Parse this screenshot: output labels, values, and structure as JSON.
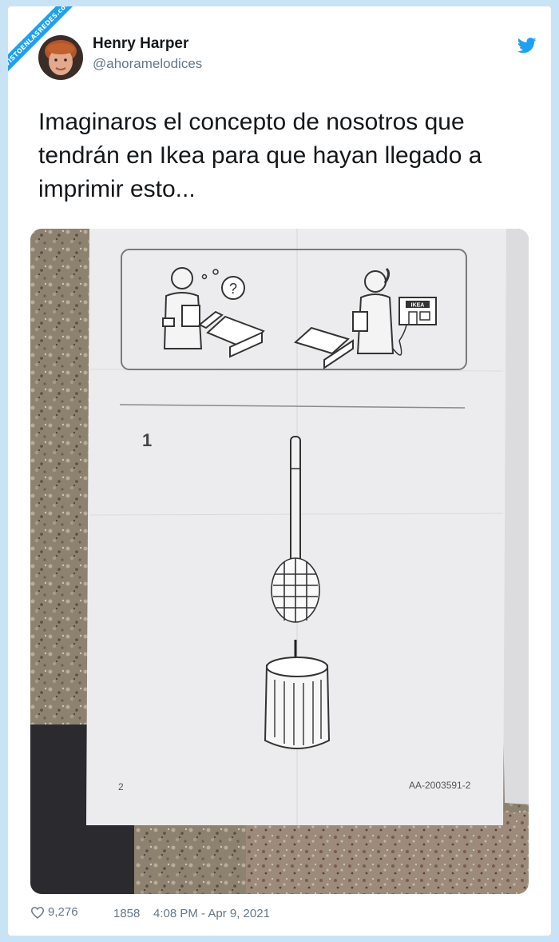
{
  "watermark": "VISTOENLASREDES.com",
  "tweet": {
    "author_name": "Henry Harper",
    "author_handle": "@ahoramelodices",
    "text": "Imaginaros el concepto de nosotros que tendrán en Ikea para que hayan llegado a imprimir esto...",
    "likes": "9,276",
    "retweets": "1858",
    "timestamp": "4:08 PM - Apr 9, 2021"
  },
  "photo": {
    "brand_label": "IKEA",
    "question_mark": "?",
    "step_number": "1",
    "page_number": "2",
    "doc_code": "AA-2003591-2"
  },
  "icons": {
    "platform": "twitter-bird-icon",
    "like": "heart-outline-icon"
  },
  "colors": {
    "accent": "#1da1f2",
    "background": "#c9e3f6",
    "secondary_text": "#657786"
  }
}
